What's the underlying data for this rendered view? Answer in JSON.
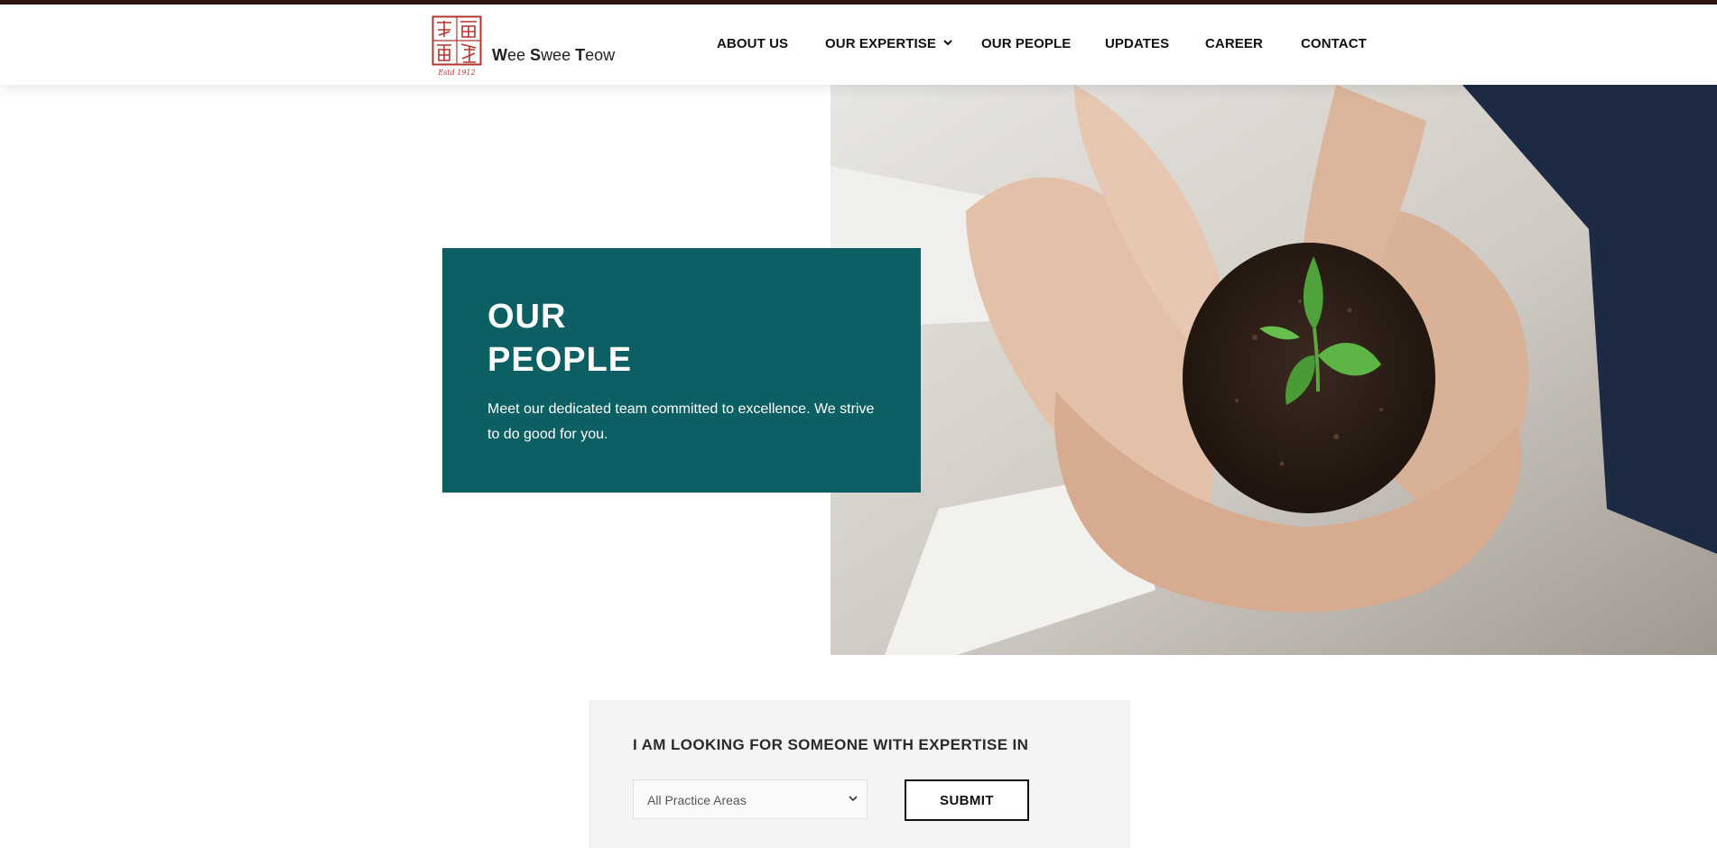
{
  "header": {
    "logo": {
      "name_parts": [
        {
          "initial": "W",
          "rest": "ee"
        },
        {
          "initial": "S",
          "rest": "wee"
        },
        {
          "initial": "T",
          "rest": "eow"
        }
      ],
      "seal_caption": "Estd 1912"
    },
    "nav": [
      {
        "label": "ABOUT US"
      },
      {
        "label": "OUR EXPERTISE",
        "has_dropdown": true
      },
      {
        "label": "OUR PEOPLE"
      },
      {
        "label": "UPDATES"
      },
      {
        "label": "CAREER"
      },
      {
        "label": "CONTACT"
      }
    ]
  },
  "hero": {
    "title_lines": [
      "OUR",
      "PEOPLE"
    ],
    "description": "Meet our dedicated team committed to excellence. We strive to do good for you.",
    "image_icon": "hands-holding-seedling-photo"
  },
  "search": {
    "label": "I AM LOOKING FOR SOMEONE WITH EXPERTISE IN",
    "select_value": "All Practice Areas",
    "submit_label": "SUBMIT"
  },
  "colors": {
    "brand_teal": "#0c5f62",
    "top_bar": "#2c1410",
    "seal_red": "#b5342e",
    "search_bg": "#f4f4f4"
  }
}
